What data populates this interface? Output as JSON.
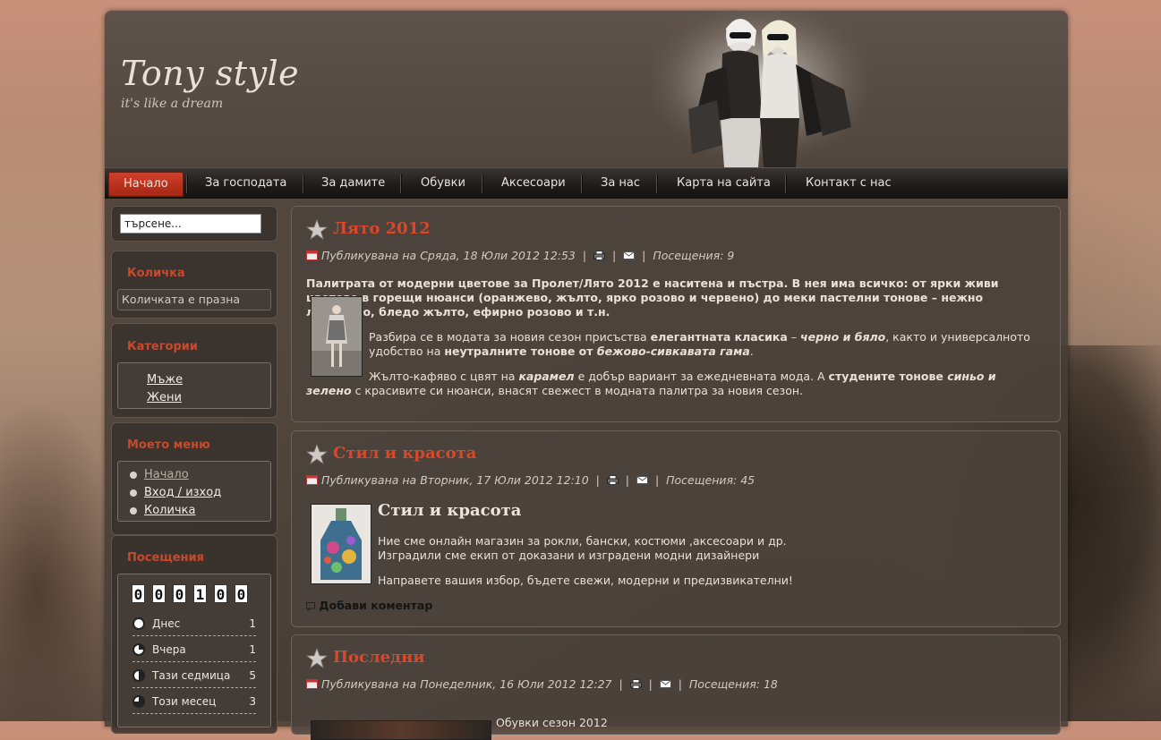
{
  "site": {
    "title": "Tony style",
    "slogan": "it's like a dream"
  },
  "menu": {
    "items": [
      {
        "label": "Начало",
        "active": true
      },
      {
        "label": "За господата"
      },
      {
        "label": "За дамите"
      },
      {
        "label": "Обувки"
      },
      {
        "label": "Аксесоари"
      },
      {
        "label": "За нас"
      },
      {
        "label": "Карта на сайта"
      },
      {
        "label": "Контакт с нас"
      }
    ]
  },
  "search": {
    "value": "търсене..."
  },
  "cart": {
    "title": "Количка",
    "empty_text": "Количката е празна"
  },
  "categories": {
    "title": "Категории",
    "items": [
      "Мъже",
      "Жени"
    ]
  },
  "my_menu": {
    "title": "Моето меню",
    "items": [
      "Начало",
      "Вход / изход",
      "Количка"
    ]
  },
  "visits": {
    "title": "Посещения",
    "counter": [
      "0",
      "0",
      "0",
      "1",
      "0",
      "0"
    ],
    "rows": [
      {
        "label": "Днес",
        "value": "1"
      },
      {
        "label": "Вчера",
        "value": "1"
      },
      {
        "label": "Тази седмица",
        "value": "5"
      },
      {
        "label": "Този месец",
        "value": "3"
      }
    ]
  },
  "articles": [
    {
      "title": "Лято 2012",
      "meta": "Публикувана на Сряда, 18 Юли 2012 12:53",
      "visits": "Посещения: 9",
      "intro_bold": "Палитрата от модерни цветове за Пролет/Лято 2012 е наситена и пъстра. В нея има всичко: от ярки живи цветове в горещи нюанси (оранжево, жълто, ярко розово и червено) до меки пастелни тонове – нежно люляково, бледо жълто, ефирно розово и т.н.",
      "p2_a": "Разбира се в модата за новия сезон присъства ",
      "p2_b": "елегантната класика",
      "p2_c": " – ",
      "p2_d": "черно и бяло",
      "p2_e": ", както и универсалното удобство на ",
      "p2_f": "неутралните тонове от ",
      "p2_g": "бежово-сивкавата гама",
      "p2_h": ".",
      "p3_a": "Жълто-кафяво с цвят на ",
      "p3_b": "карамел",
      "p3_c": " е добър вариант за ежедневната мода. А ",
      "p3_d": "студените тонове ",
      "p3_e": "синьо и зелено",
      "p3_f": " с красивите си нюанси, внасят свежест в модната палитра за новия сезон."
    },
    {
      "title": "Стил и красота",
      "meta": "Публикувана на Вторник, 17 Юли 2012 12:10",
      "visits": "Посещения: 45",
      "heading": "Стил и красота",
      "line1": "Ние сме онлайн магазин за рокли, бански, костюми ,аксесоари и др.",
      "line2": "Изградили сме екип от доказани и изградени модни дизайнери",
      "line3": "Направете вашия избор, бъдете свежи, модерни и предизвикателни!",
      "comment": "Добави коментар"
    },
    {
      "title": "Последни",
      "meta": "Публикувана на Понеделник, 16 Юли 2012 12:27",
      "visits": "Посещения: 18",
      "line1": "Обувки сезон 2012"
    }
  ],
  "colors": {
    "accent": "#d9482a",
    "menu_active": "#c0321d"
  }
}
